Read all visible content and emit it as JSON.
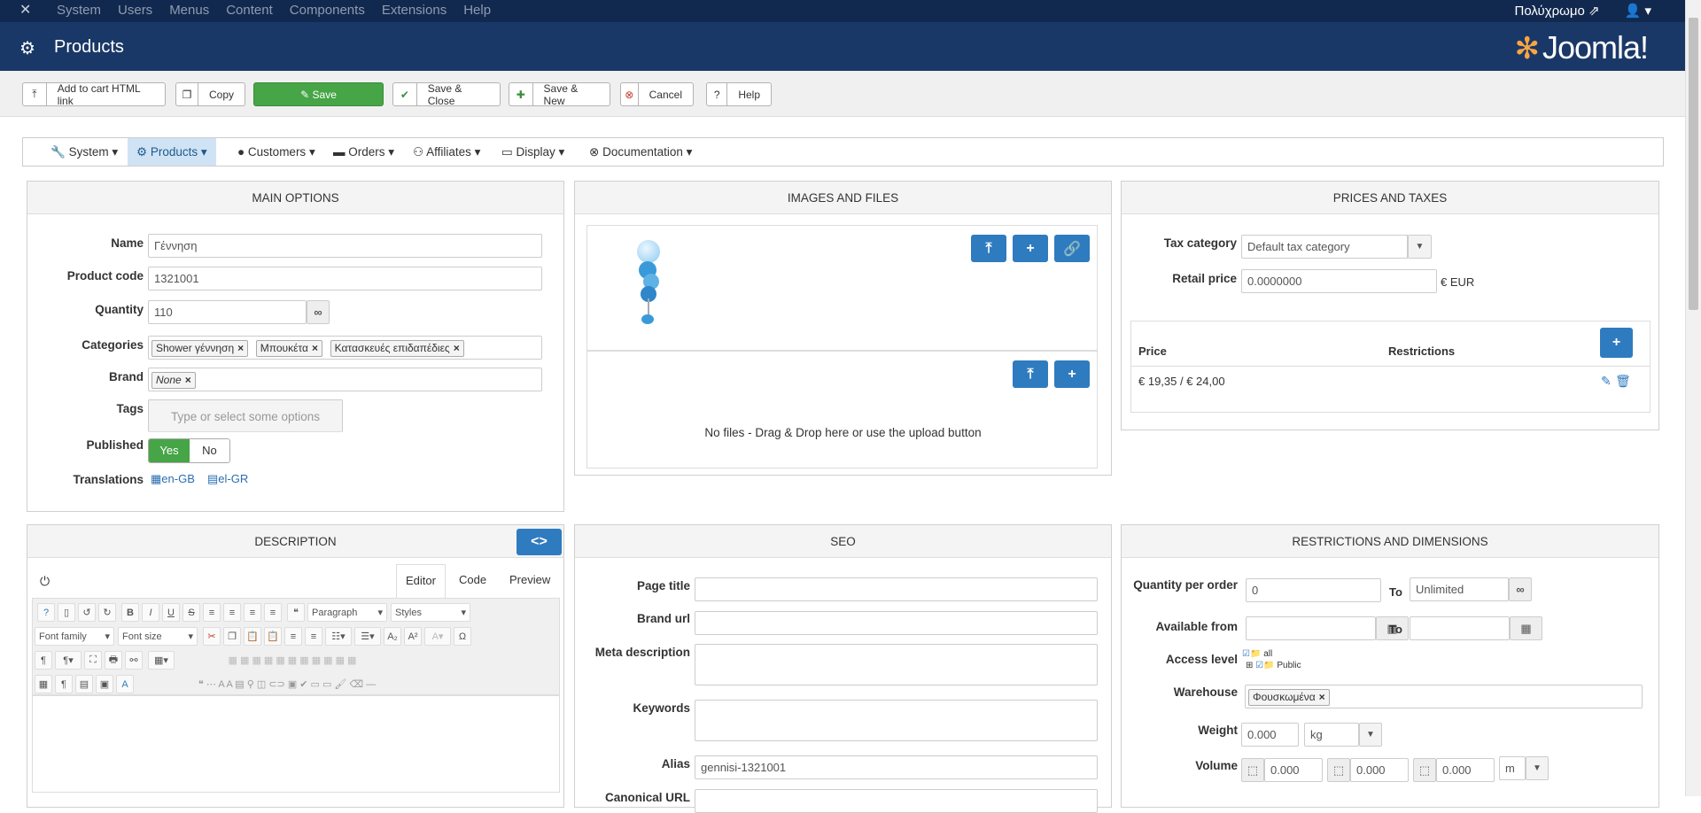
{
  "topbar": {
    "menu": [
      "System",
      "Users",
      "Menus",
      "Content",
      "Components",
      "Extensions",
      "Help"
    ],
    "site": "Πολύχρωμο"
  },
  "header": {
    "title": "Products",
    "brand": "Joomla!"
  },
  "toolbar": {
    "add_cart": "Add to cart HTML link",
    "copy": "Copy",
    "save": "Save",
    "save_close": "Save & Close",
    "save_new": "Save & New",
    "cancel": "Cancel",
    "help": "Help"
  },
  "subnav": [
    "System",
    "Products",
    "Customers",
    "Orders",
    "Affiliates",
    "Display",
    "Documentation"
  ],
  "main": {
    "title": "MAIN OPTIONS",
    "name_label": "Name",
    "name": "Γέννηση",
    "code_label": "Product code",
    "code": "1321001",
    "qty_label": "Quantity",
    "qty": "110",
    "cat_label": "Categories",
    "categories": [
      "Shower γέννηση",
      "Μπουκέτα",
      "Κατασκευές επιδαπέδιες"
    ],
    "brand_label": "Brand",
    "brand": "None",
    "tags_label": "Tags",
    "tags_placeholder": "Type or select some options",
    "pub_label": "Published",
    "yes": "Yes",
    "no": "No",
    "trans_label": "Translations",
    "lang1": "en-GB",
    "lang2": "el-GR"
  },
  "images": {
    "title": "IMAGES AND FILES",
    "nofiles": "No files - Drag & Drop here or use the upload button"
  },
  "prices": {
    "title": "PRICES AND TAXES",
    "tax_label": "Tax category",
    "tax": "Default tax category",
    "retail_label": "Retail price",
    "retail": "0.0000000",
    "currency": "€ EUR",
    "col_price": "Price",
    "col_restr": "Restrictions",
    "row_price": "€ 19,35 / € 24,00"
  },
  "desc": {
    "title": "DESCRIPTION",
    "tab_editor": "Editor",
    "tab_code": "Code",
    "tab_preview": "Preview",
    "paragraph": "Paragraph",
    "styles": "Styles",
    "fontfamily": "Font family",
    "fontsize": "Font size"
  },
  "seo": {
    "title": "SEO",
    "page_title": "Page title",
    "brand_url": "Brand url",
    "meta": "Meta description",
    "keywords": "Keywords",
    "alias_label": "Alias",
    "alias": "gennisi-1321001",
    "canonical": "Canonical URL"
  },
  "restr": {
    "title": "RESTRICTIONS AND DIMENSIONS",
    "qpo": "Quantity per order",
    "qpo_val": "0",
    "to": "To",
    "unlimited": "Unlimited",
    "avail": "Available from",
    "access": "Access level",
    "all": "all",
    "public": "Public",
    "warehouse_label": "Warehouse",
    "warehouse": "Φουσκωμένα",
    "weight_label": "Weight",
    "weight": "0.000",
    "kg": "kg",
    "volume_label": "Volume",
    "v1": "0.000",
    "v2": "0.000",
    "v3": "0.000",
    "m": "m"
  }
}
